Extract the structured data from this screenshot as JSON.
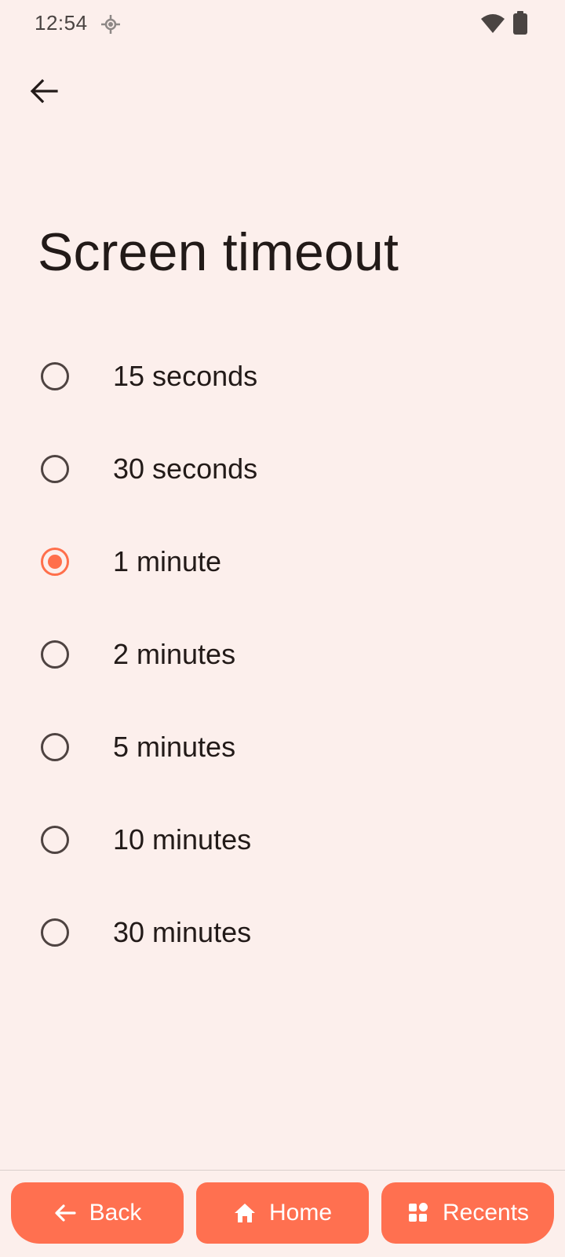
{
  "status_bar": {
    "time": "12:54",
    "icons": [
      "location-icon",
      "wifi-icon",
      "battery-icon"
    ]
  },
  "header": {
    "back_icon": "arrow-left-icon",
    "title": "Screen timeout"
  },
  "options": [
    {
      "label": "15 seconds",
      "checked": false
    },
    {
      "label": "30 seconds",
      "checked": false
    },
    {
      "label": "1 minute",
      "checked": true
    },
    {
      "label": "2 minutes",
      "checked": false
    },
    {
      "label": "5 minutes",
      "checked": false
    },
    {
      "label": "10 minutes",
      "checked": false
    },
    {
      "label": "30 minutes",
      "checked": false
    }
  ],
  "nav_bar": {
    "back_label": "Back",
    "home_label": "Home",
    "recents_label": "Recents"
  },
  "colors": {
    "background": "#FCEFEC",
    "accent": "#FF6F4B",
    "text": "#221A18"
  }
}
